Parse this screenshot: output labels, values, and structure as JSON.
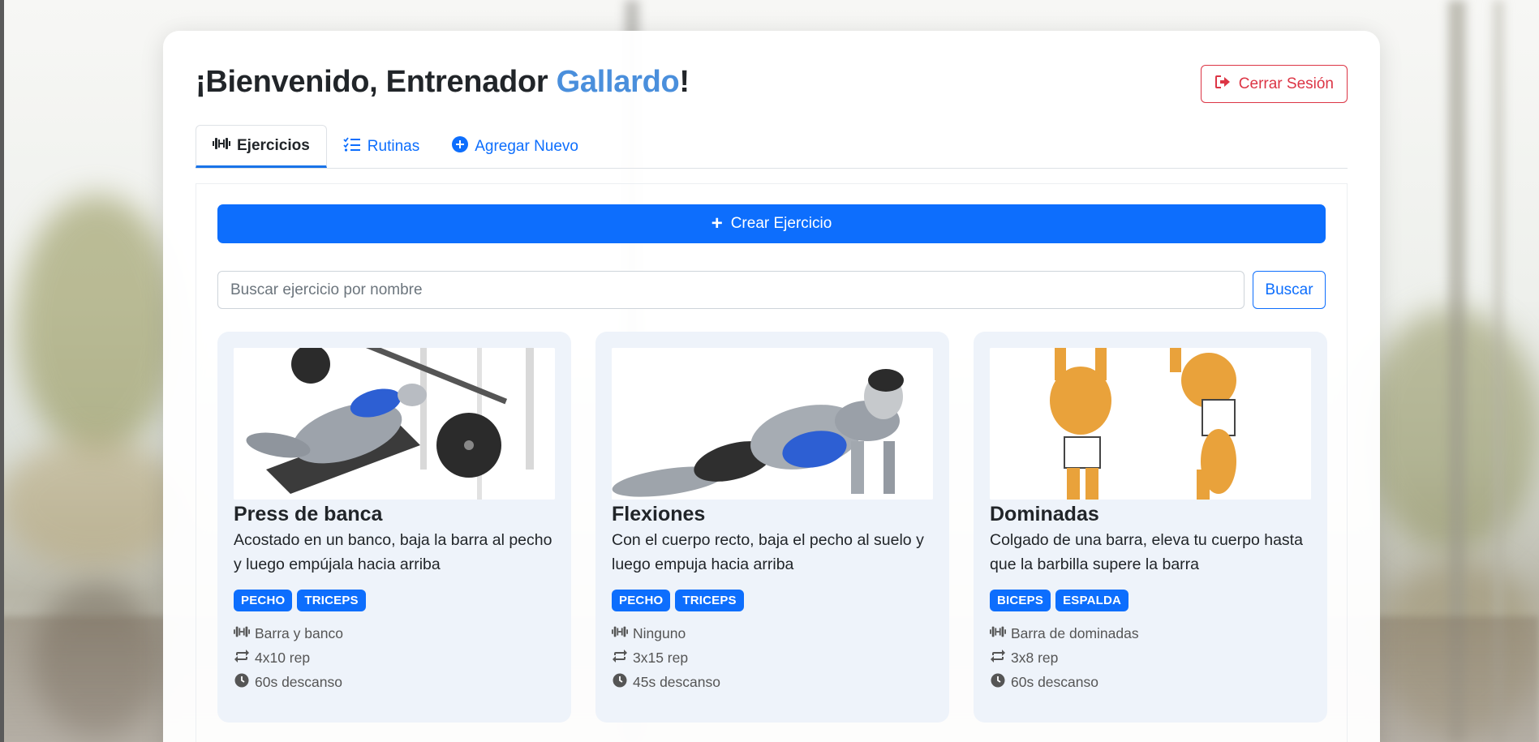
{
  "header": {
    "welcome_prefix": "¡Bienvenido, Entrenador ",
    "trainer_name": "Gallardo",
    "welcome_suffix": "!",
    "logout_label": "Cerrar Sesión"
  },
  "tabs": [
    {
      "label": "Ejercicios",
      "icon": "dumbbell-icon",
      "active": true
    },
    {
      "label": "Rutinas",
      "icon": "list-check-icon",
      "active": false
    },
    {
      "label": "Agregar Nuevo",
      "icon": "plus-circle-icon",
      "active": false
    }
  ],
  "actions": {
    "create_label": "Crear Ejercicio"
  },
  "search": {
    "placeholder": "Buscar ejercicio por nombre",
    "value": "",
    "button_label": "Buscar"
  },
  "exercises": [
    {
      "title": "Press de banca",
      "description": "Acostado en un banco, baja la barra al pecho y luego empújala hacia arriba",
      "tags": [
        "PECHO",
        "TRICEPS"
      ],
      "equipment": "Barra y banco",
      "reps": "4x10 rep",
      "rest": "60s descanso"
    },
    {
      "title": "Flexiones",
      "description": "Con el cuerpo recto, baja el pecho al suelo y luego empuja hacia arriba",
      "tags": [
        "PECHO",
        "TRICEPS"
      ],
      "equipment": "Ninguno",
      "reps": "3x15 rep",
      "rest": "45s descanso"
    },
    {
      "title": "Dominadas",
      "description": "Colgado de una barra, eleva tu cuerpo hasta que la barbilla supere la barra",
      "tags": [
        "BICEPS",
        "ESPALDA"
      ],
      "equipment": "Barra de dominadas",
      "reps": "3x8 rep",
      "rest": "60s descanso"
    }
  ],
  "colors": {
    "primary": "#0d6efd",
    "danger": "#dc3545",
    "trainer_name": "#4a8fdc",
    "card_bg": "#eef3fa"
  }
}
